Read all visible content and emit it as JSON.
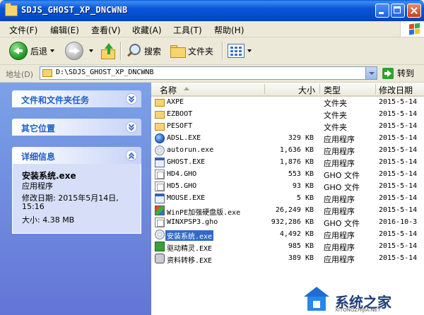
{
  "window": {
    "title": "SDJS_GHOST_XP_DNCWNB"
  },
  "menu": [
    "文件(F)",
    "编辑(E)",
    "查看(V)",
    "收藏(A)",
    "工具(T)",
    "帮助(H)"
  ],
  "toolbar": {
    "back": "后退",
    "search": "搜索",
    "folders": "文件夹"
  },
  "address": {
    "label": "地址(D)",
    "path": "D:\\SDJS_GHOST_XP_DNCWNB",
    "go": "转到"
  },
  "panels": {
    "tasks": "文件和文件夹任务",
    "other": "其它位置",
    "details": {
      "title": "详细信息",
      "name": "安装系统.exe",
      "type": "应用程序",
      "modified_label": "修改日期: 2015年5月14日,",
      "modified_time": "15:16",
      "size": "大小: 4.38 MB"
    }
  },
  "columns": {
    "name": "名称",
    "size": "大小",
    "type": "类型",
    "date": "修改日期"
  },
  "files": [
    {
      "icon": "folder-icon",
      "name": "AXPE",
      "size": "",
      "type": "文件夹",
      "date": "2015-5-14"
    },
    {
      "icon": "folder-icon",
      "name": "EZBOOT",
      "size": "",
      "type": "文件夹",
      "date": "2015-5-14"
    },
    {
      "icon": "folder-icon",
      "name": "PESOFT",
      "size": "",
      "type": "文件夹",
      "date": "2015-5-14"
    },
    {
      "icon": "globe-icon",
      "name": "ADSL.EXE",
      "size": "329 KB",
      "type": "应用程序",
      "date": "2015-5-14"
    },
    {
      "icon": "cd-icon",
      "name": "autorun.exe",
      "size": "1,636 KB",
      "type": "应用程序",
      "date": "2015-5-14"
    },
    {
      "icon": "exe-icon",
      "name": "GHOST.EXE",
      "size": "1,876 KB",
      "type": "应用程序",
      "date": "2015-5-14"
    },
    {
      "icon": "gho-icon",
      "name": "HD4.GHO",
      "size": "553 KB",
      "type": "GHO 文件",
      "date": "2015-5-14"
    },
    {
      "icon": "gho-icon",
      "name": "HD5.GHO",
      "size": "93 KB",
      "type": "GHO 文件",
      "date": "2015-5-14"
    },
    {
      "icon": "exe-icon",
      "name": "MOUSE.EXE",
      "size": "5 KB",
      "type": "应用程序",
      "date": "2015-5-14"
    },
    {
      "icon": "color-icon",
      "name": "WinPE加强硬盘版.exe",
      "size": "26,249 KB",
      "type": "应用程序",
      "date": "2015-5-14"
    },
    {
      "icon": "gho-icon",
      "name": "WINXPSP3.gho",
      "size": "932,286 KB",
      "type": "GHO 文件",
      "date": "2016-10-3"
    },
    {
      "icon": "cd-icon",
      "name": "安装系统.exe",
      "size": "4,492 KB",
      "type": "应用程序",
      "date": "2015-5-14",
      "selected": true
    },
    {
      "icon": "green-icon",
      "name": "驱动精灵.EXE",
      "size": "985 KB",
      "type": "应用程序",
      "date": "2015-5-14"
    },
    {
      "icon": "gear-icon",
      "name": "资料转移.EXE",
      "size": "389 KB",
      "type": "应用程序",
      "date": "2015-5-14"
    }
  ],
  "watermark": {
    "text": "系统之家",
    "sub": "XITONGZHIJIA.NET"
  },
  "colors": {
    "title_bar": "#0a55d8",
    "task_pane": "#7ba2e7",
    "selection": "#316ac5",
    "panel_title": "#215dc6"
  }
}
